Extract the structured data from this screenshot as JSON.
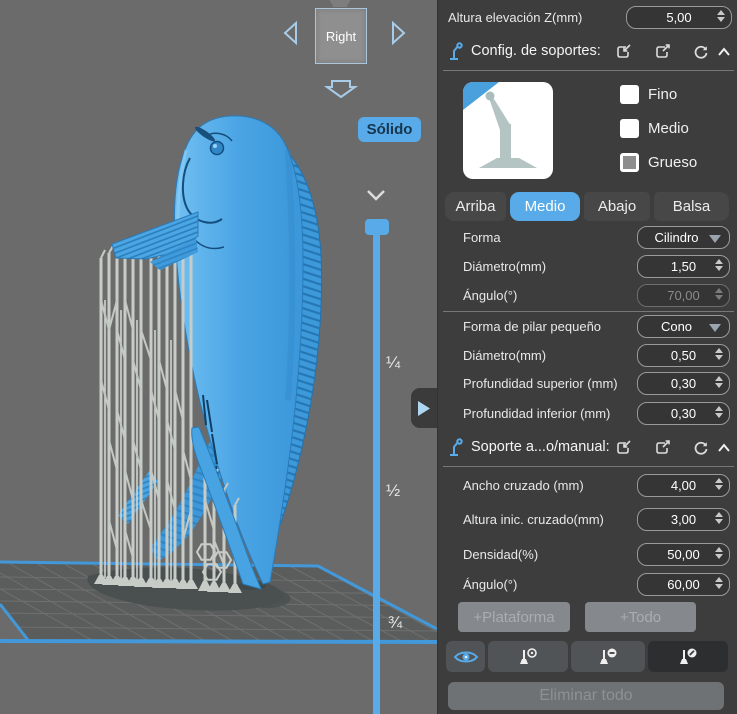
{
  "panel": {
    "z_lift": {
      "label": "Altura elevación Z(mm)",
      "value": "5,00"
    },
    "support_config": {
      "title": "Config. de soportes:",
      "options": [
        {
          "label": "Fino"
        },
        {
          "label": "Medio"
        },
        {
          "label": "Grueso"
        }
      ],
      "tabs": [
        {
          "label": "Arriba"
        },
        {
          "label": "Medio"
        },
        {
          "label": "Abajo"
        },
        {
          "label": "Balsa"
        }
      ],
      "fields": {
        "forma": {
          "label": "Forma",
          "value": "Cilindro"
        },
        "diametro": {
          "label": "Diámetro(mm)",
          "value": "1,50"
        },
        "angulo": {
          "label": "Ángulo(°)",
          "value": "70,00"
        },
        "forma_pilar": {
          "label": "Forma de pilar pequeño",
          "value": "Cono"
        },
        "diametro_pilar": {
          "label": "Diámetro(mm)",
          "value": "0,50"
        },
        "prof_sup": {
          "label": "Profundidad superior (mm)",
          "value": "0,30"
        },
        "prof_inf": {
          "label": "Profundidad inferior (mm)",
          "value": "0,30"
        }
      }
    },
    "support_manual": {
      "title": "Soporte a...o/manual:",
      "fields": {
        "ancho": {
          "label": "Ancho cruzado (mm)",
          "value": "4,00"
        },
        "altura": {
          "label": "Altura inic. cruzado(mm)",
          "value": "3,00"
        },
        "densidad": {
          "label": "Densidad(%)",
          "value": "50,00"
        },
        "angulo": {
          "label": "Ángulo(°)",
          "value": "60,00"
        }
      },
      "add_platform_label": "+Plataforma",
      "add_all_label": "+Todo",
      "delete_all_label": "Eliminar todo"
    }
  },
  "viewport": {
    "view_cube_face": "Right",
    "render_mode_label": "Sólido",
    "slider_marks": [
      "¼",
      "½",
      "¾"
    ]
  },
  "colors": {
    "accent": "#58aae8",
    "panel_bg": "#3d3d3d",
    "viewport_bg": "#6b6b6b",
    "model_blue": "#47a3e1",
    "support_gray": "#c7ccc7",
    "plate_outline": "#4298d8"
  }
}
